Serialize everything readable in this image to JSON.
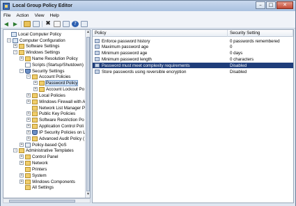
{
  "window": {
    "title": "Local Group Policy Editor"
  },
  "window_controls": {
    "minimize": "–",
    "maximize": "□",
    "close": "✕"
  },
  "menu": [
    "File",
    "Action",
    "View",
    "Help"
  ],
  "toolbar": {
    "back": "◀",
    "forward": "▶",
    "delete": "✖",
    "help": "?"
  },
  "tree": [
    {
      "label": "Local Computer Policy",
      "icon": "pc-icon",
      "exp": ""
    },
    {
      "label": "Computer Configuration",
      "icon": "pc-icon",
      "exp": "−"
    },
    {
      "label": "Software Settings",
      "icon": "folder-icon",
      "exp": "+"
    },
    {
      "label": "Windows Settings",
      "icon": "folder-icon",
      "exp": "−"
    },
    {
      "label": "Name Resolution Policy",
      "icon": "folder-icon",
      "exp": "+"
    },
    {
      "label": "Scripts (Startup/Shutdown)",
      "icon": "doc-icon",
      "exp": ""
    },
    {
      "label": "Security Settings",
      "icon": "shield-icon",
      "exp": "−"
    },
    {
      "label": "Account Policies",
      "icon": "folder-icon",
      "exp": "−"
    },
    {
      "label": "Password Policy",
      "icon": "folder-icon",
      "exp": "+"
    },
    {
      "label": "Account Lockout Po",
      "icon": "folder-icon",
      "exp": "+"
    },
    {
      "label": "Local Policies",
      "icon": "folder-icon",
      "exp": "+"
    },
    {
      "label": "Windows Firewall with A",
      "icon": "folder-icon",
      "exp": "+"
    },
    {
      "label": "Network List Manager P",
      "icon": "folder-icon",
      "exp": ""
    },
    {
      "label": "Public Key Policies",
      "icon": "folder-icon",
      "exp": "+"
    },
    {
      "label": "Software Restriction Po",
      "icon": "folder-icon",
      "exp": "+"
    },
    {
      "label": "Application Control Poli",
      "icon": "folder-icon",
      "exp": "+"
    },
    {
      "label": "IP Security Policies on L",
      "icon": "shield-icon",
      "exp": "+"
    },
    {
      "label": "Advanced Audit Policy (",
      "icon": "folder-icon",
      "exp": "+"
    },
    {
      "label": "Policy-based QoS",
      "icon": "graph-icon",
      "exp": "+"
    },
    {
      "label": "Administrative Templates",
      "icon": "folder-icon",
      "exp": "−"
    },
    {
      "label": "Control Panel",
      "icon": "folder-icon",
      "exp": "+"
    },
    {
      "label": "Network",
      "icon": "folder-icon",
      "exp": "+"
    },
    {
      "label": "Printers",
      "icon": "folder-icon",
      "exp": ""
    },
    {
      "label": "System",
      "icon": "folder-icon",
      "exp": "+"
    },
    {
      "label": "Windows Components",
      "icon": "folder-icon",
      "exp": "+"
    },
    {
      "label": "All Settings",
      "icon": "folder-icon",
      "exp": ""
    }
  ],
  "list": {
    "columns": [
      "Policy",
      "Security Setting"
    ],
    "rows": [
      {
        "policy": "Enforce password history",
        "setting": "0 passwords remembered"
      },
      {
        "policy": "Maximum password age",
        "setting": "0"
      },
      {
        "policy": "Minimum password age",
        "setting": "0 days"
      },
      {
        "policy": "Minimum password length",
        "setting": "0 characters"
      },
      {
        "policy": "Password must meet complexity requirements",
        "setting": "Disabled"
      },
      {
        "policy": "Store passwords using reversible encryption",
        "setting": "Disabled"
      }
    ],
    "selected_index": 4
  }
}
